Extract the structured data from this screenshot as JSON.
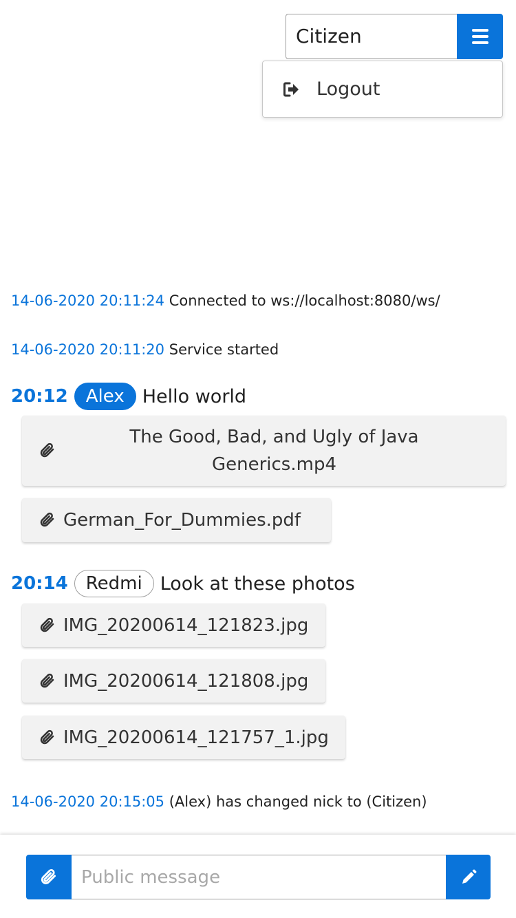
{
  "header": {
    "nickname_value": "Citizen",
    "menu_icon": "hamburger-icon",
    "dropdown": {
      "logout_label": "Logout",
      "logout_icon": "sign-out-icon"
    }
  },
  "log": [
    {
      "timestamp": "14-06-2020 20:11:24",
      "text": "Connected to ws://localhost:8080/ws/"
    },
    {
      "timestamp": "14-06-2020 20:11:20",
      "text": "Service started"
    },
    {
      "timestamp": "14-06-2020 20:15:05",
      "text": "(Alex) has changed nick to (Citizen)"
    }
  ],
  "messages": [
    {
      "time": "20:12",
      "nick": "Alex",
      "text": "Hello world",
      "files": [
        "The Good, Bad, and Ugly of Java Generics.mp4",
        "German_For_Dummies.pdf"
      ]
    },
    {
      "time": "20:14",
      "nick": "Redmi",
      "text": "Look at these photos",
      "files": [
        "IMG_20200614_121823.jpg",
        "IMG_20200614_121808.jpg",
        "IMG_20200614_121757_1.jpg"
      ]
    }
  ],
  "composer": {
    "placeholder": "Public message",
    "value": "",
    "attach_icon": "paperclip-icon",
    "send_icon": "pencil-icon"
  },
  "colors": {
    "accent": "#0a74da",
    "file_bg": "#f2f2f2",
    "border": "#9e9e9e"
  }
}
